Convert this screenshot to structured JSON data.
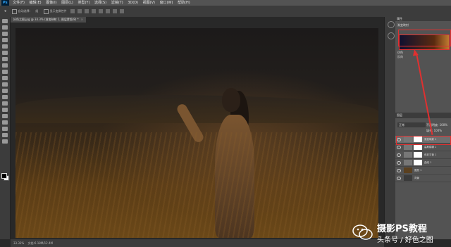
{
  "menubar": {
    "logo": "Ps",
    "items": [
      "文件(F)",
      "编辑(E)",
      "图像(I)",
      "图层(L)",
      "类型(Y)",
      "选择(S)",
      "滤镜(T)",
      "3D(D)",
      "视图(V)",
      "窗口(W)",
      "帮助(H)"
    ]
  },
  "optionsbar": {
    "auto_select": "自动选择:",
    "auto_select_target": "组",
    "show_transform": "显示变换控件"
  },
  "document_tab": {
    "title": "好色之图.jpg @ 33.3% (渐变映射 1, 图层蒙版/8) *",
    "close": "×"
  },
  "status": {
    "zoom": "33.33%",
    "doc_size": "文档:6.18M/12.4M"
  },
  "panels": {
    "properties_header": "属性",
    "adjustment_name": "渐变映射",
    "option1": "仿色",
    "option2": "反向",
    "layers_header": "图层",
    "blend_mode": "正常",
    "opacity_label": "不透明度: 100%",
    "fill_label": "填充: 100%",
    "layers": [
      {
        "name": "渐变映射 1",
        "selected": true
      },
      {
        "name": "高斯模糊 1",
        "selected": false
      },
      {
        "name": "色彩平衡 1",
        "selected": false
      },
      {
        "name": "曲线 1",
        "selected": false
      },
      {
        "name": "图层 1",
        "selected": false
      },
      {
        "name": "背景",
        "selected": false
      }
    ]
  },
  "watermark": {
    "title": "摄影PS教程",
    "subtitle": "头条号 / 好色之图"
  },
  "colors": {
    "accent_red": "#e03030",
    "panel": "#535353",
    "toolbar": "#3c3c3c"
  }
}
